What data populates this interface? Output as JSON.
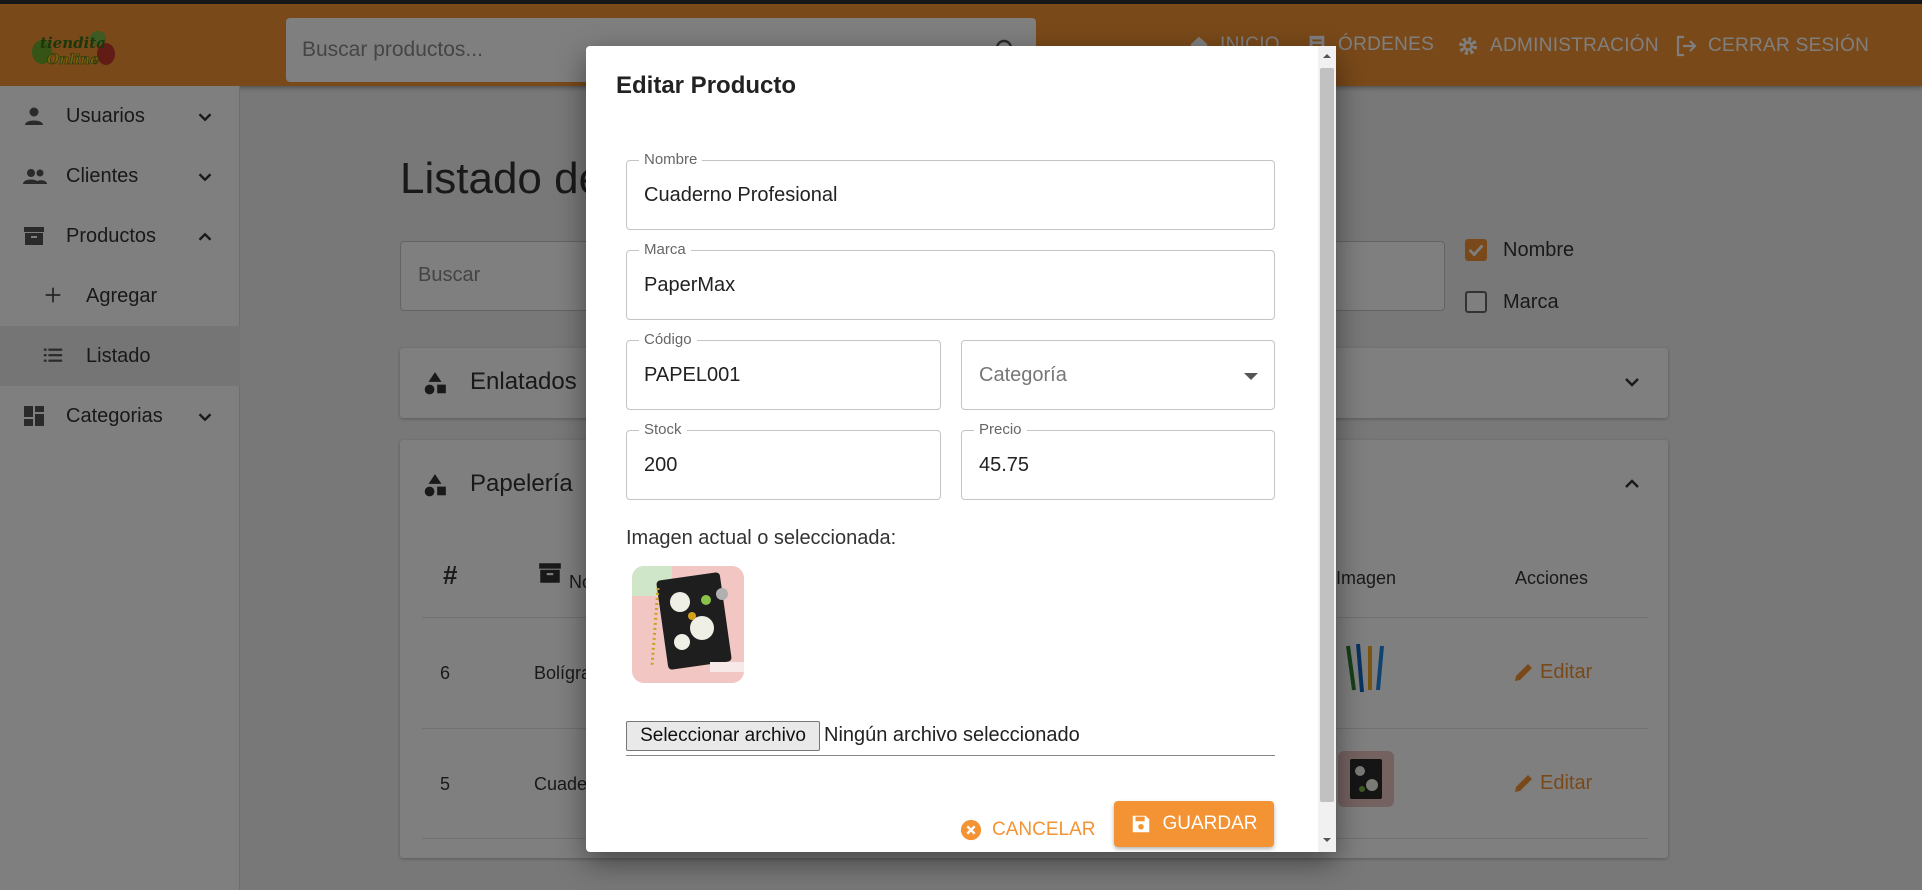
{
  "header": {
    "search_placeholder": "Buscar productos...",
    "nav": [
      {
        "label": "INICIO",
        "icon": "home-icon"
      },
      {
        "label": "ÓRDENES",
        "icon": "receipt-icon"
      },
      {
        "label": "ADMINISTRACIÓN",
        "icon": "gear-icon"
      },
      {
        "label": "CERRAR SESIÓN",
        "icon": "logout-icon"
      }
    ],
    "brand_color": "#f39333"
  },
  "sidebar": {
    "items": [
      {
        "label": "Usuarios"
      },
      {
        "label": "Clientes"
      },
      {
        "label": "Productos"
      },
      {
        "label": "Agregar"
      },
      {
        "label": "Listado"
      },
      {
        "label": "Categorias"
      }
    ]
  },
  "main": {
    "title": "Listado de",
    "search_placeholder": "Buscar",
    "filters": [
      {
        "label": "Nombre",
        "checked": true
      },
      {
        "label": "Marca",
        "checked": false
      }
    ],
    "categories": [
      {
        "name": "Enlatados",
        "expanded": false
      },
      {
        "name": "Papelería",
        "expanded": true
      }
    ],
    "table": {
      "headers": {
        "index": "#",
        "name": "No",
        "image": "Imagen",
        "actions": "Acciones"
      },
      "rows": [
        {
          "id": "6",
          "name": "Bolígra",
          "action": "Editar"
        },
        {
          "id": "5",
          "name": "Cuade",
          "action": "Editar"
        }
      ]
    }
  },
  "modal": {
    "title": "Editar Producto",
    "fields": {
      "nombre": {
        "label": "Nombre",
        "value": "Cuaderno Profesional"
      },
      "marca": {
        "label": "Marca",
        "value": "PaperMax"
      },
      "codigo": {
        "label": "Código",
        "value": "PAPEL001"
      },
      "categoria": {
        "placeholder": "Categoría"
      },
      "stock": {
        "label": "Stock",
        "value": "200"
      },
      "precio": {
        "label": "Precio",
        "value": "45.75"
      }
    },
    "image_label": "Imagen actual o seleccionada:",
    "file_button": "Seleccionar archivo",
    "file_status": "Ningún archivo seleccionado",
    "cancel_label": "CANCELAR",
    "save_label": "GUARDAR"
  }
}
